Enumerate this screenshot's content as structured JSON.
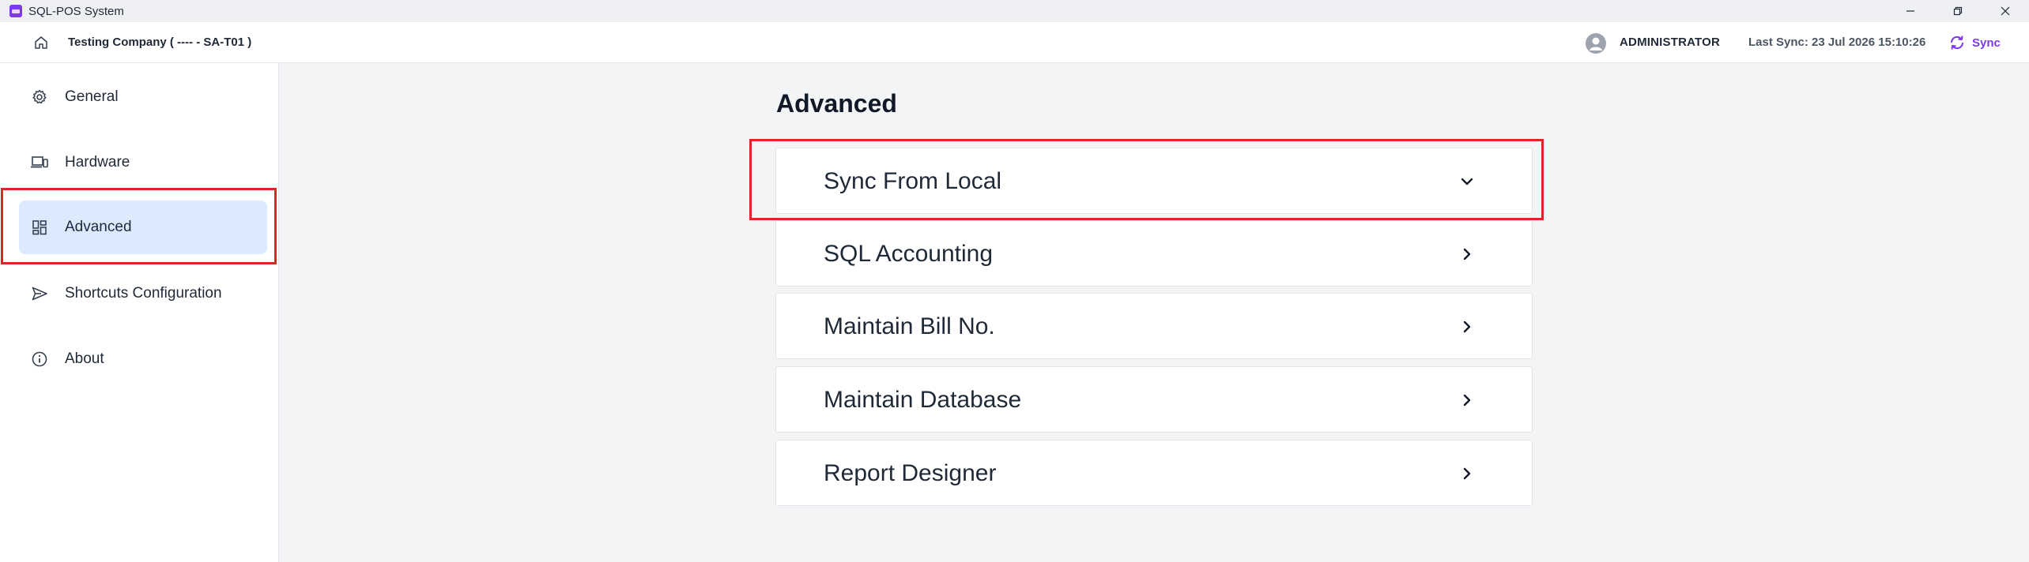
{
  "window": {
    "title": "SQL-POS System",
    "controls": [
      "minimize-icon",
      "restore-icon",
      "close-icon"
    ]
  },
  "topbar": {
    "company": "Testing Company ( ---- - SA-T01 )",
    "user": "ADMINISTRATOR",
    "last_sync": "Last Sync: 23 Jul 2026 15:10:26",
    "sync_label": "Sync"
  },
  "sidebar": {
    "items": [
      {
        "label": "General",
        "icon": "gear-icon"
      },
      {
        "label": "Hardware",
        "icon": "devices-icon"
      },
      {
        "label": "Advanced",
        "icon": "dashboard-icon",
        "active": true
      },
      {
        "label": "Shortcuts Configuration",
        "icon": "send-icon"
      },
      {
        "label": "About",
        "icon": "info-icon"
      }
    ]
  },
  "main": {
    "title": "Advanced",
    "panels": [
      {
        "label": "Sync From Local",
        "expanded": true
      },
      {
        "label": "SQL Accounting",
        "expanded": false
      },
      {
        "label": "Maintain Bill No.",
        "expanded": false
      },
      {
        "label": "Maintain Database",
        "expanded": false
      },
      {
        "label": "Report Designer",
        "expanded": false
      }
    ]
  },
  "colors": {
    "accent": "#7c3aed",
    "active_bg": "#dbeafe",
    "highlight": "#dc2626"
  }
}
